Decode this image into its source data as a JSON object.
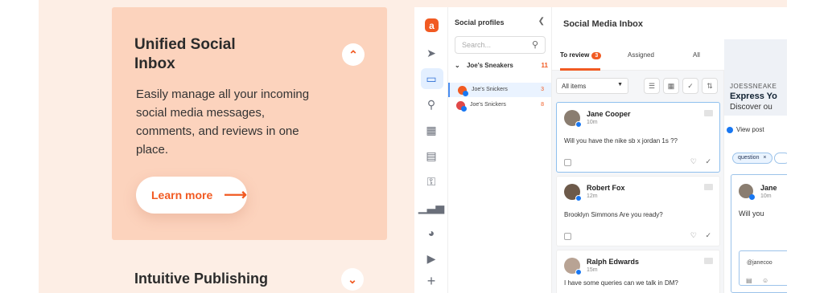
{
  "accordion": {
    "item1": {
      "title": "Unified Social Inbox",
      "description": "Easily manage all your incoming social media messages, comments, and reviews in one place.",
      "learn_more": "Learn more",
      "toggle_icon": "chevron-up-icon"
    },
    "item2": {
      "title": "Intuitive Publishing",
      "toggle_icon": "chevron-down-icon"
    }
  },
  "app": {
    "logo": "a",
    "profiles": {
      "title": "Social profiles",
      "search_placeholder": "Search...",
      "group": {
        "name": "Joe's Sneakers",
        "count": "11"
      },
      "items": [
        {
          "name": "Joe's Snickers",
          "count": "3"
        },
        {
          "name": "Joe's Snickers",
          "count": "8"
        }
      ]
    },
    "inbox": {
      "title": "Social Media Inbox",
      "tabs": [
        {
          "label": "To review",
          "badge": "3"
        },
        {
          "label": "Assigned"
        },
        {
          "label": "All"
        }
      ],
      "filter": "All items",
      "messages": [
        {
          "name": "Jane Cooper",
          "time": "10m",
          "text": "Will you have the nike sb x jordan 1s ??"
        },
        {
          "name": "Robert Fox",
          "time": "12m",
          "text": "Brooklyn Simmons Are you ready?"
        },
        {
          "name": "Ralph Edwards",
          "time": "15m",
          "text": "I have some queries can we talk in DM?"
        }
      ]
    },
    "detail": {
      "ad_line1": "JOESSNEAKE",
      "ad_line2": "Express Yo",
      "ad_line3": "Discover ou",
      "view_post": "View post",
      "tag": "question",
      "tag_close": "×",
      "card": {
        "name": "Jane",
        "time": "10m",
        "text": "Will you"
      },
      "reply_text": "@janecoo"
    }
  },
  "colors": {
    "accent": "#f15a22",
    "card_bg": "#fcd3bd",
    "page_bg": "#fdeee5",
    "facebook": "#1877f2"
  }
}
